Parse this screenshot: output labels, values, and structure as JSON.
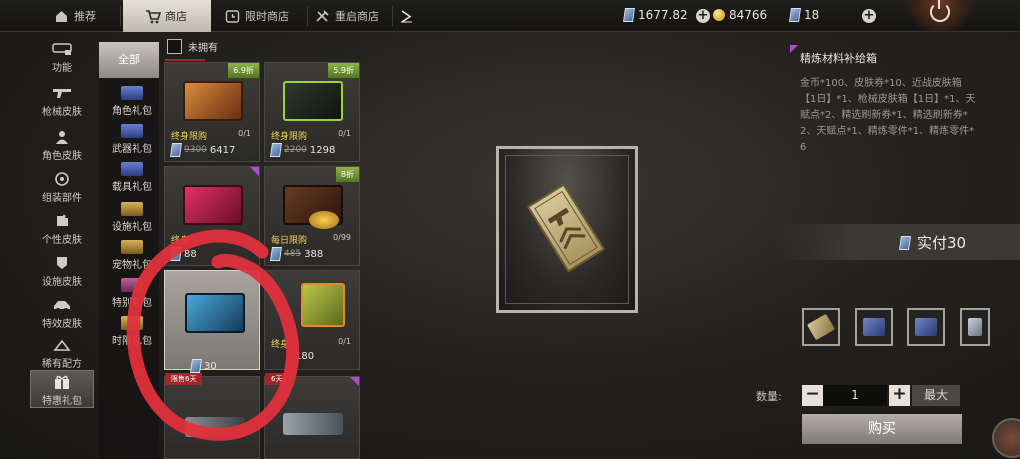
{
  "topbar": {
    "tabs": [
      {
        "label": "推荐",
        "icon": "home-icon"
      },
      {
        "label": "商店",
        "icon": "cart-icon",
        "active": true
      },
      {
        "label": "限时商店",
        "icon": "clock-icon"
      },
      {
        "label": "重启商店",
        "icon": "restart-icon"
      }
    ],
    "more_icon": "chevron-right-icon",
    "currencies": {
      "tickets": "1677.82",
      "gold": "84766",
      "vouchers": "18"
    },
    "power_icon": "power-icon"
  },
  "left_nav": [
    {
      "label": "功能",
      "icon": "function-icon"
    },
    {
      "label": "枪械皮肤",
      "icon": "gun-icon"
    },
    {
      "label": "角色皮肤",
      "icon": "person-icon"
    },
    {
      "label": "组装部件",
      "icon": "wheel-icon"
    },
    {
      "label": "个性皮肤",
      "icon": "puzzle-icon"
    },
    {
      "label": "设施皮肤",
      "icon": "shield-icon"
    },
    {
      "label": "特效皮肤",
      "icon": "vehicle-icon"
    },
    {
      "label": "稀有配方",
      "icon": "formula-icon"
    },
    {
      "label": "特惠礼包",
      "icon": "gift-icon",
      "active": true
    }
  ],
  "sub_nav": {
    "all_label": "全部",
    "items": [
      "角色礼包",
      "武器礼包",
      "载具礼包",
      "设施礼包",
      "宠物礼包",
      "特别礼包",
      "时限礼包"
    ]
  },
  "filter": {
    "label": "未拥有",
    "checked": false
  },
  "products": [
    {
      "discount": "6.9折",
      "limit": "终身限购",
      "limit_count": "0/1",
      "old_price": "9300",
      "price": "6417"
    },
    {
      "discount": "5.9折",
      "limit": "终身限购",
      "limit_count": "0/1",
      "old_price": "2200",
      "price": "1298"
    },
    {
      "limit": "终身",
      "price": "88"
    },
    {
      "discount": "8折",
      "limit": "每日限购",
      "limit_count": "0/99",
      "old_price": "485",
      "price": "388"
    },
    {
      "tag": "限售6天",
      "price": "30",
      "selected": true
    },
    {
      "limit": "终身",
      "limit_count": "0/1",
      "price": "180"
    },
    {
      "tag": "限售6天"
    },
    {
      "tag": "6天"
    }
  ],
  "detail": {
    "title": "精炼材料补给箱",
    "description": "金币*100、皮肤券*10、近战皮肤箱【1日】*1、枪械皮肤箱【1日】*1、天赋点*2、精选刷新券*1、精选刷新券*2、天赋点*1、精炼零件*1、精炼零件*6",
    "pay_label": "实付30",
    "quantity_label": "数量:",
    "quantity": "1",
    "minus_label": "−",
    "plus_label": "+",
    "max_label": "最大",
    "buy_label": "购买"
  },
  "colors": {
    "accent_purple": "#b34ac9",
    "discount_green": "#6e9a32",
    "limit_gold": "#f1d05a",
    "annotation_red": "#e0303c"
  }
}
